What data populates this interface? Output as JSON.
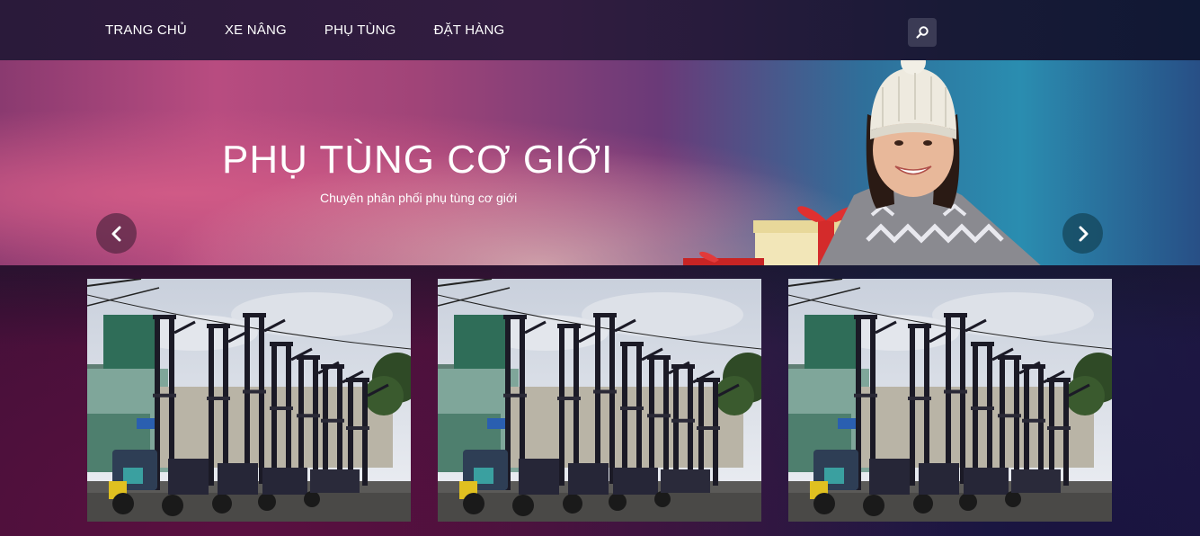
{
  "nav": {
    "items": [
      {
        "label": "TRANG CHỦ"
      },
      {
        "label": "XE NÂNG"
      },
      {
        "label": "PHỤ TÙNG"
      },
      {
        "label": "ĐẶT HÀNG"
      }
    ],
    "search_icon": "search-icon"
  },
  "hero": {
    "title": "PHỤ TÙNG CƠ GIỚI",
    "subtitle": "Chuyên phân phối phụ tùng cơ giới",
    "prev_icon": "chevron-left-icon",
    "next_icon": "chevron-right-icon"
  },
  "gallery": {
    "items": [
      {
        "image": "forklift-photo"
      },
      {
        "image": "forklift-photo"
      },
      {
        "image": "forklift-photo"
      }
    ]
  },
  "colors": {
    "nav_text": "#ffffff",
    "hero_pink": "#b84c80",
    "hero_teal": "#2a8db0"
  }
}
